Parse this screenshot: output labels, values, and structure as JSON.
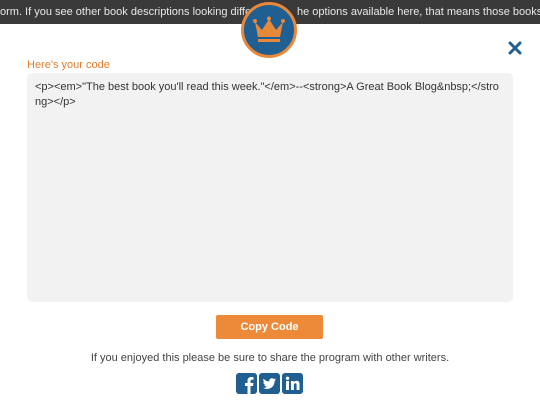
{
  "background_banner": {
    "text_left": "orm. If you see other book descriptions looking diffe",
    "text_right": "he options available here, that means those books w"
  },
  "logo": {
    "icon": "crown-icon",
    "bg_color": "#1f5f92",
    "ring_color": "#e8883a"
  },
  "modal": {
    "close_icon": "close-icon",
    "heading": "Here's your code",
    "code": "<p><em>\"The best book you'll read this week.\"</em>--<strong>A Great Book Blog&nbsp;</strong></p>",
    "copy_button_label": "Copy Code",
    "share_text": "If you enjoyed this please be sure to share the program with other writers.",
    "share_icons": [
      "facebook-icon",
      "twitter-icon",
      "linkedin-icon"
    ]
  },
  "colors": {
    "accent": "#ec8a3a",
    "heading": "#e07f2f",
    "close": "#1f5f92",
    "social": "#1f5f92"
  }
}
